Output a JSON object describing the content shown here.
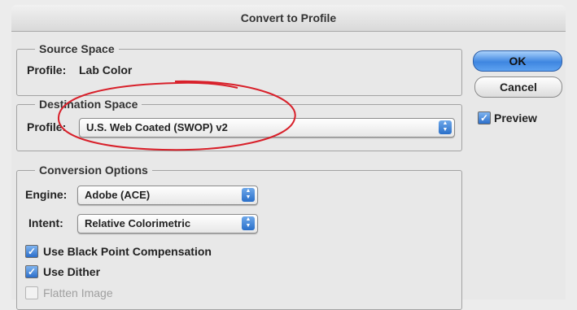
{
  "dialog": {
    "title": "Convert to Profile"
  },
  "source_space": {
    "legend": "Source Space",
    "profile_label": "Profile:",
    "profile_value": "Lab Color"
  },
  "destination_space": {
    "legend": "Destination Space",
    "profile_label": "Profile:",
    "profile_value": "U.S. Web Coated (SWOP) v2"
  },
  "conversion_options": {
    "legend": "Conversion Options",
    "engine_label": "Engine:",
    "engine_value": "Adobe (ACE)",
    "intent_label": "Intent:",
    "intent_value": "Relative Colorimetric",
    "black_point_label": "Use Black Point Compensation",
    "black_point_checked": true,
    "dither_label": "Use Dither",
    "dither_checked": true,
    "flatten_label": "Flatten Image",
    "flatten_checked": false,
    "flatten_enabled": false
  },
  "buttons": {
    "ok": "OK",
    "cancel": "Cancel"
  },
  "preview": {
    "label": "Preview",
    "checked": true
  },
  "colors": {
    "annotation": "#d8202a",
    "accent": "#3e86e0"
  }
}
